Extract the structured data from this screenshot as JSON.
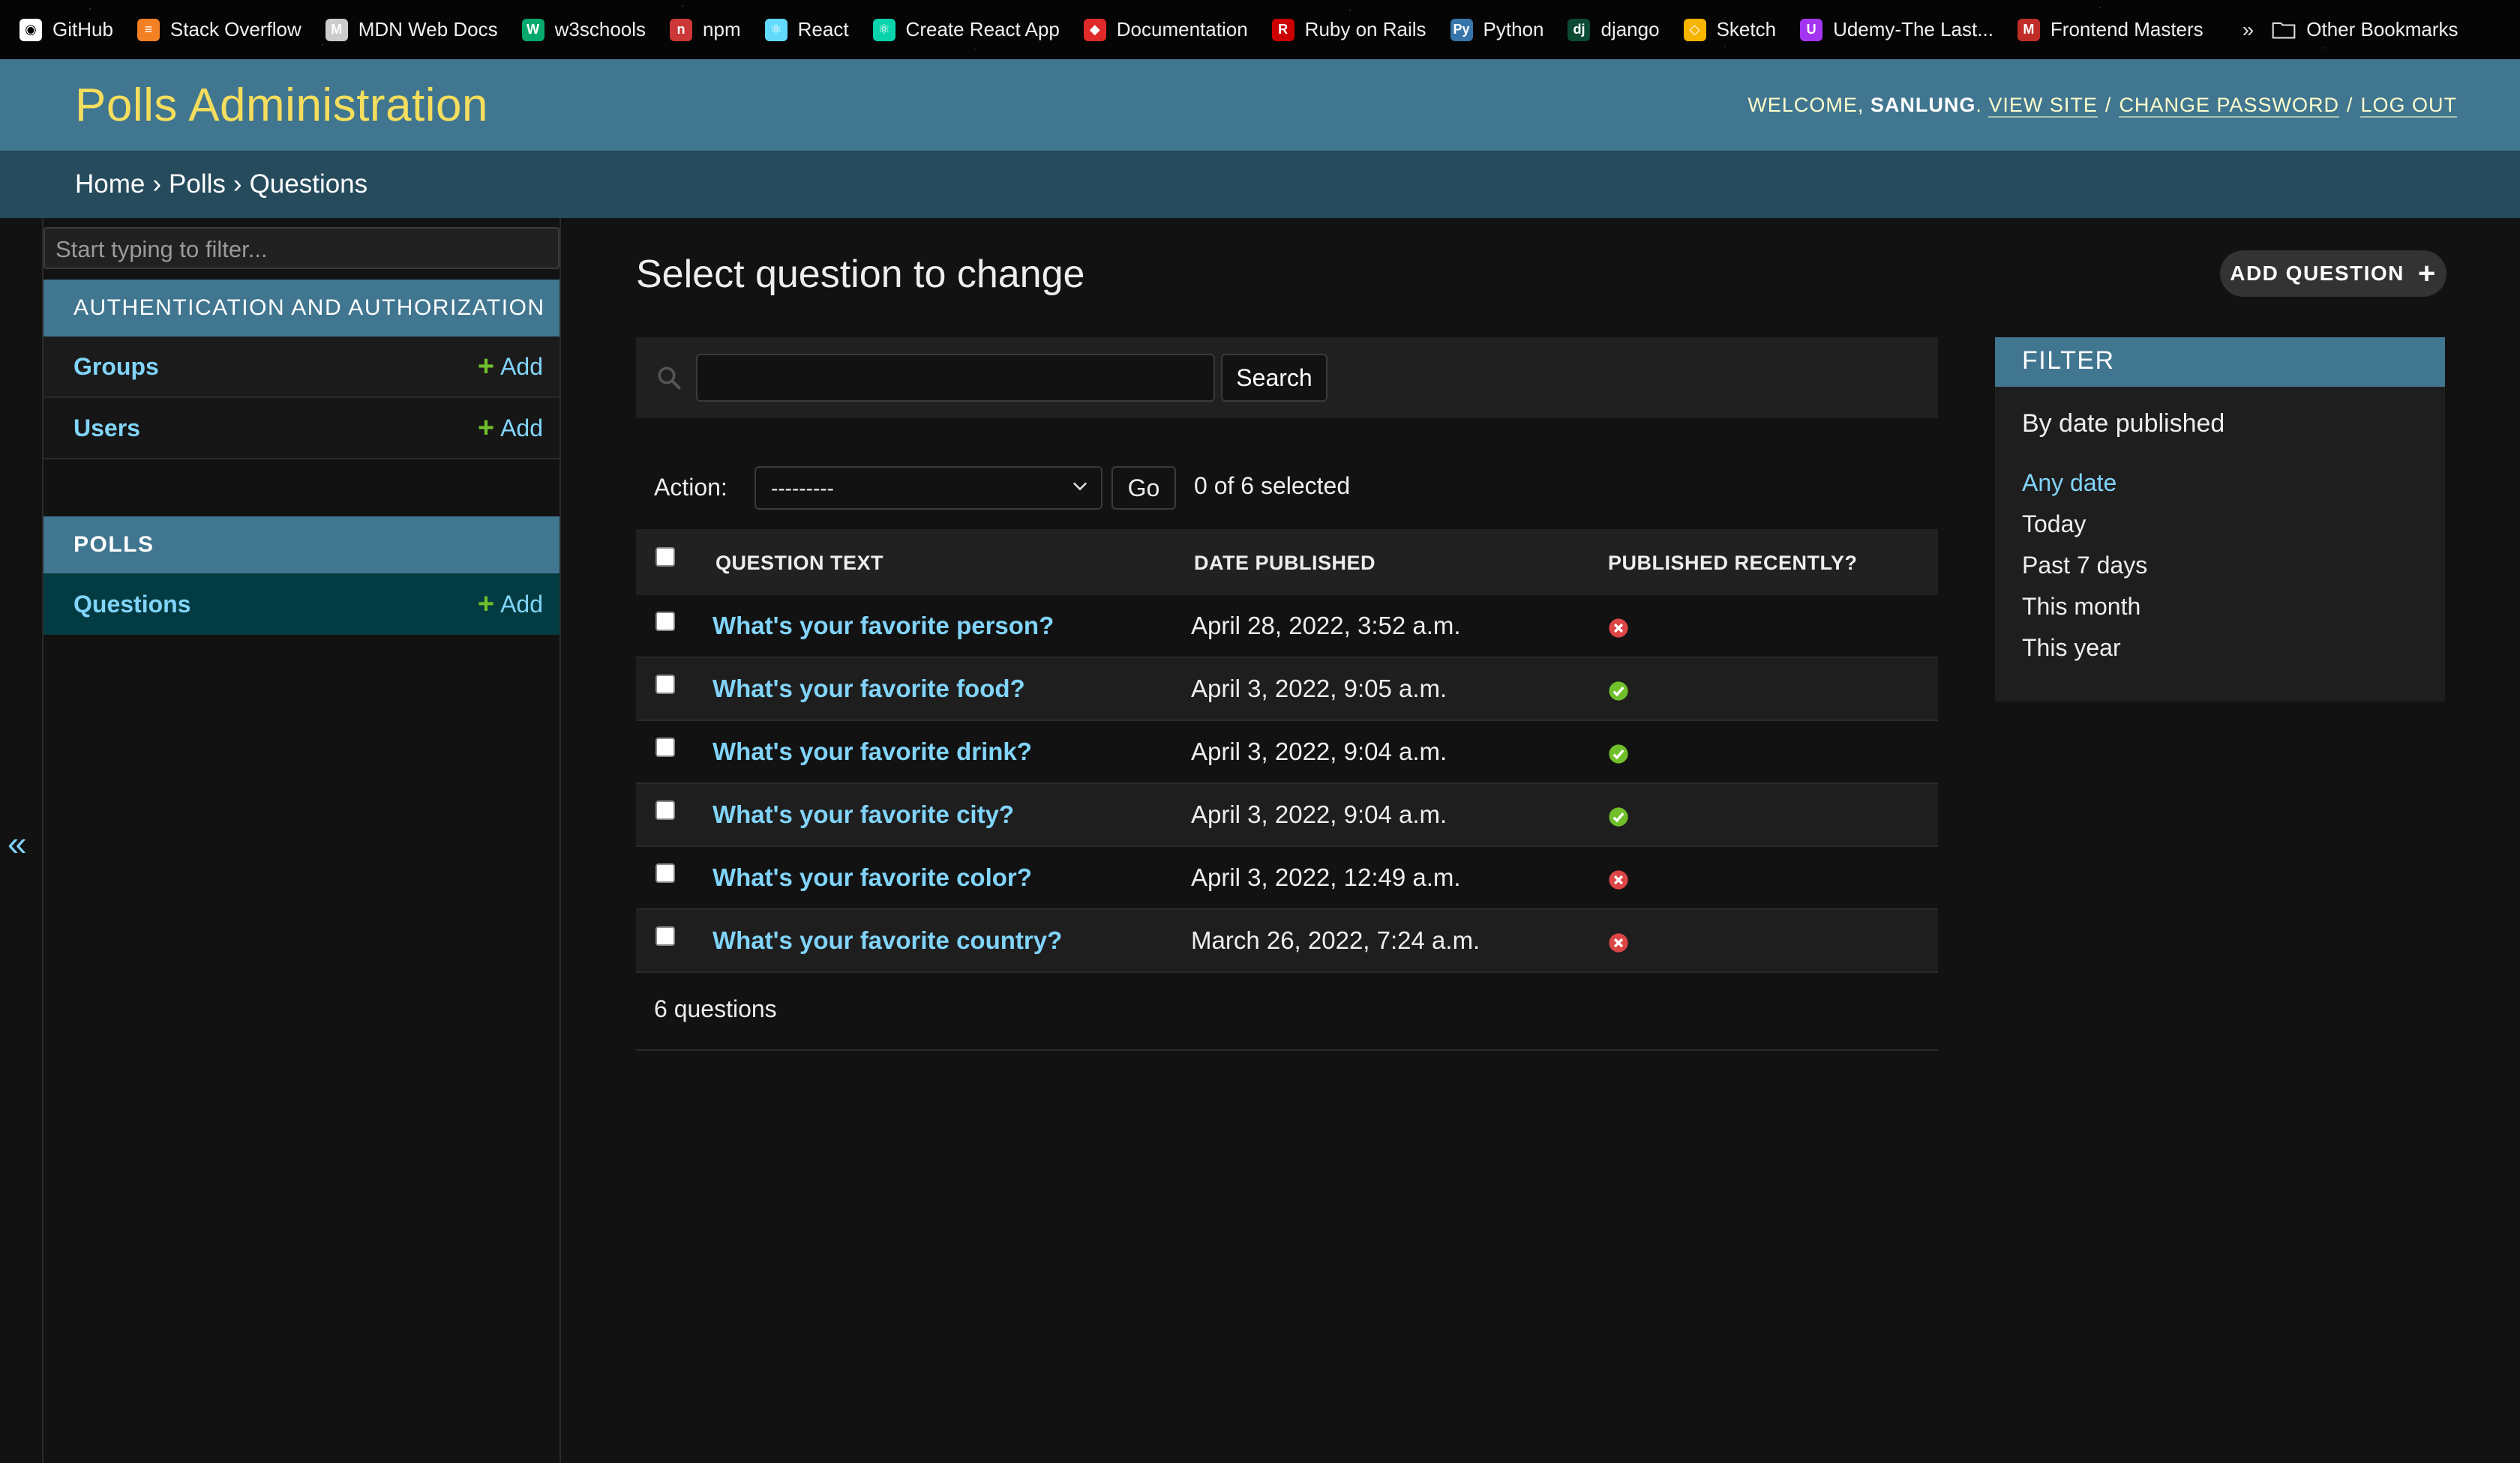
{
  "bookmarks": [
    {
      "label": "GitHub",
      "icon": "github-icon",
      "color": "#ffffff"
    },
    {
      "label": "Stack Overflow",
      "icon": "stackoverflow-icon",
      "color": "#f48024"
    },
    {
      "label": "MDN Web Docs",
      "icon": "mdn-icon",
      "color": "#cccccc"
    },
    {
      "label": "w3schools",
      "icon": "w3schools-icon",
      "color": "#04aa6d"
    },
    {
      "label": "npm",
      "icon": "npm-icon",
      "color": "#cb3837"
    },
    {
      "label": "React",
      "icon": "react-icon",
      "color": "#61dafb"
    },
    {
      "label": "Create React App",
      "icon": "create-react-app-icon",
      "color": "#09d3ac"
    },
    {
      "label": "Documentation",
      "icon": "documentation-icon",
      "color": "#e02a2a"
    },
    {
      "label": "Ruby on Rails",
      "icon": "rails-icon",
      "color": "#cc0000"
    },
    {
      "label": "Python",
      "icon": "python-icon",
      "color": "#3776ab"
    },
    {
      "label": "django",
      "icon": "django-icon",
      "color": "#0c4b33"
    },
    {
      "label": "Sketch",
      "icon": "sketch-icon",
      "color": "#f7b500"
    },
    {
      "label": "Udemy-The Last...",
      "icon": "udemy-icon",
      "color": "#a435f0"
    },
    {
      "label": "Frontend Masters",
      "icon": "frontend-masters-icon",
      "color": "#c02d28"
    }
  ],
  "bookmarks_more": "»",
  "bookmarks_other": "Other Bookmarks",
  "header": {
    "brand": "Polls Administration",
    "welcome": "Welcome,",
    "username": "sanlung",
    "view_site": "View site",
    "change_password": "Change password",
    "log_out": "Log out"
  },
  "breadcrumbs": {
    "home": "Home",
    "app": "Polls",
    "current": "Questions"
  },
  "sidebar": {
    "filter_placeholder": "Start typing to filter...",
    "auth_caption": "Authentication and Authorization",
    "auth_models": [
      {
        "name": "Groups",
        "add": "Add"
      },
      {
        "name": "Users",
        "add": "Add"
      }
    ],
    "polls_caption": "Polls",
    "polls_models": [
      {
        "name": "Questions",
        "add": "Add"
      }
    ],
    "collapse": "«"
  },
  "main": {
    "title": "Select question to change",
    "add_button": "Add question",
    "search_button": "Search",
    "action_label": "Action:",
    "action_selected": "---------",
    "go_button": "Go",
    "selected_count": "0 of 6 selected",
    "columns": [
      "Question text",
      "Date published",
      "Published recently?"
    ],
    "rows": [
      {
        "question": "What's your favorite person?",
        "date": "April 28, 2022, 3:52 a.m.",
        "recent": false
      },
      {
        "question": "What's your favorite food?",
        "date": "April 3, 2022, 9:05 a.m.",
        "recent": true
      },
      {
        "question": "What's your favorite drink?",
        "date": "April 3, 2022, 9:04 a.m.",
        "recent": true
      },
      {
        "question": "What's your favorite city?",
        "date": "April 3, 2022, 9:04 a.m.",
        "recent": true
      },
      {
        "question": "What's your favorite color?",
        "date": "April 3, 2022, 12:49 a.m.",
        "recent": false
      },
      {
        "question": "What's your favorite country?",
        "date": "March 26, 2022, 7:24 a.m.",
        "recent": false
      }
    ],
    "paginator": "6 questions"
  },
  "filter": {
    "title": "Filter",
    "by": "By date published",
    "options": [
      "Any date",
      "Today",
      "Past 7 days",
      "This month",
      "This year"
    ],
    "selected_index": 0
  },
  "colors": {
    "header": "#417690",
    "breadcrumbs": "#264b5d",
    "brand": "#f5dd5d",
    "link": "#81d4fa",
    "add_green": "#70bf2b",
    "yes": "#70bf2b",
    "no": "#dd4646"
  }
}
